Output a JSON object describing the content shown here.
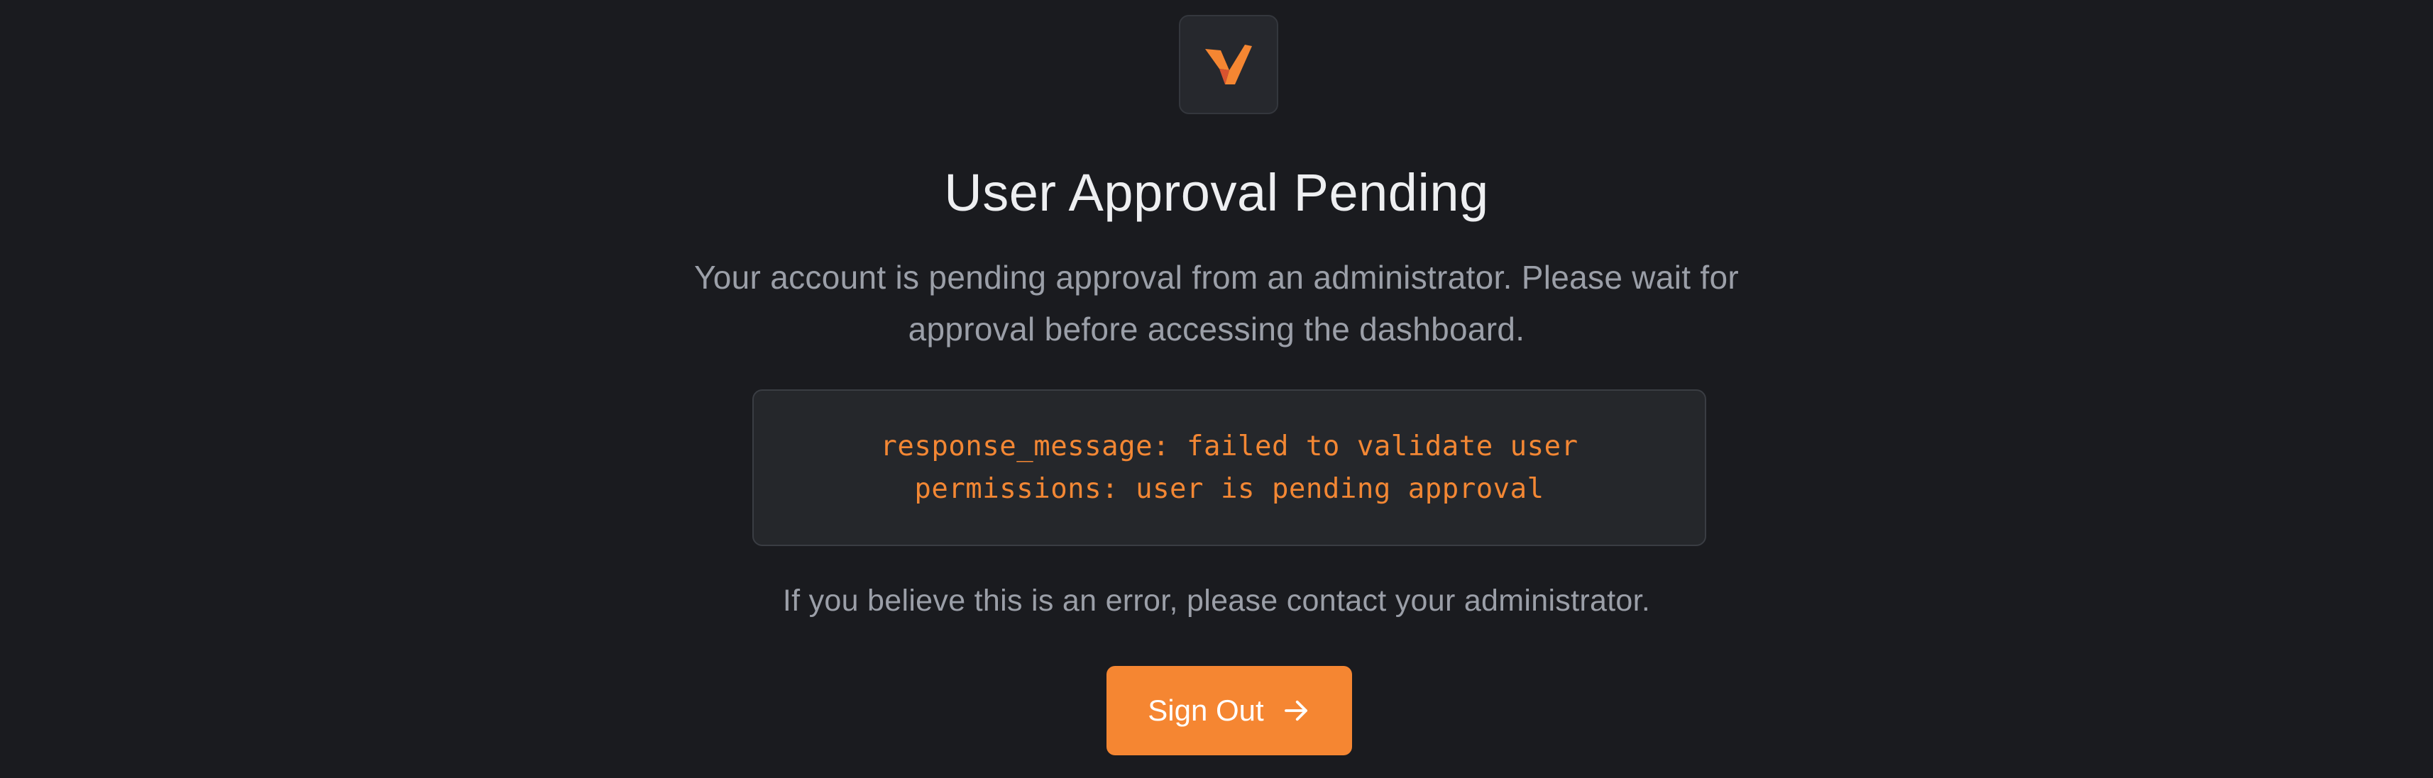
{
  "logo": {
    "icon": "brand-logo-icon",
    "colors": [
      "#f58632",
      "#d9532f"
    ]
  },
  "heading": {
    "title": "User Approval Pending"
  },
  "message": {
    "line1": "Your account is pending approval from an administrator. Please wait for",
    "line2": "approval before accessing the dashboard."
  },
  "error": {
    "line1": "response_message: failed to validate user",
    "line2": "permissions: user is pending approval"
  },
  "help_text": "If you believe this is an error, please contact your administrator.",
  "sign_out": {
    "label": "Sign Out",
    "icon": "arrow-right-icon"
  },
  "colors": {
    "background": "#1a1b1f",
    "accent": "#f58632",
    "error_text": "#f38734"
  }
}
